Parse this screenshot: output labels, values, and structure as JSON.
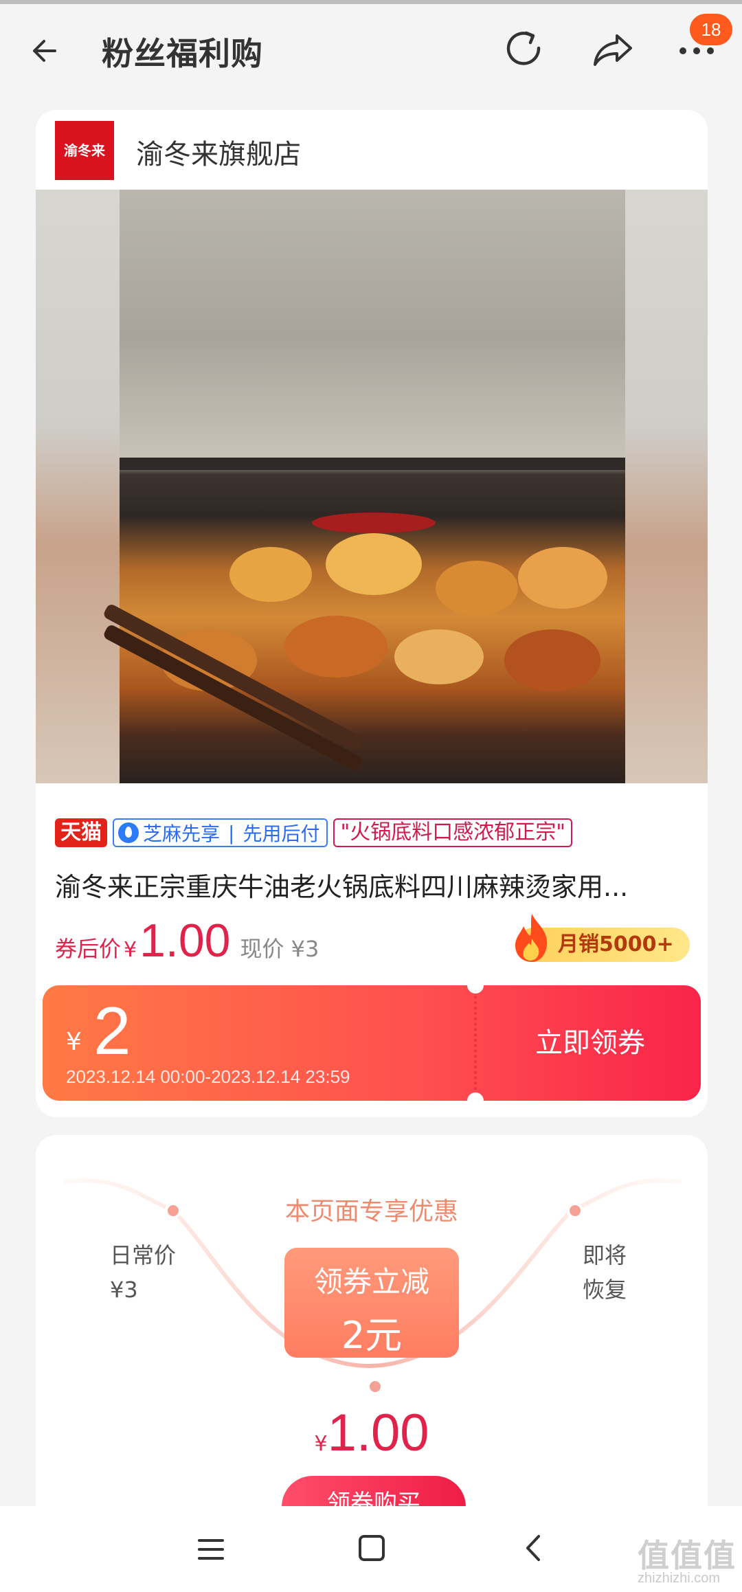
{
  "header": {
    "title": "粉丝福利购",
    "badge_count": "18",
    "icons": [
      "arrow-left-icon",
      "refresh-icon",
      "share-icon",
      "more-dots-icon"
    ]
  },
  "store": {
    "logo_text": "渝冬来",
    "name": "渝冬来旗舰店"
  },
  "product": {
    "tags": {
      "tmall": "天猫",
      "credit_a": "芝麻先享",
      "credit_sep": "|",
      "credit_b": "先用后付",
      "slogan": "\"火锅底料口感浓郁正宗\""
    },
    "title": "渝冬来正宗重庆牛油老火锅底料四川麻辣烫家用...",
    "after_coupon_label": "券后价",
    "currency": "¥",
    "after_coupon_price": "1.00",
    "current_price": "现价 ¥3",
    "monthly_sales": "月销5000+"
  },
  "coupon": {
    "currency": "¥",
    "amount": "2",
    "validity": "2023.12.14 00:00-2023.12.14 23:59",
    "claim_label": "立即领券"
  },
  "promo": {
    "title": "本页面专享优惠",
    "left_label_1": "日常价",
    "left_label_2": "¥3",
    "right_label_1": "即将",
    "right_label_2": "恢复",
    "deal_line1": "领券立减",
    "deal_line2": "2元",
    "final_currency": "¥",
    "final_price": "1.00",
    "buy_label": "领券购买"
  },
  "colors": {
    "accent_red": "#e0234a",
    "coupon_orange": "#ff7a45",
    "tmall_red": "#e2231a",
    "credit_blue": "#2b6cf0"
  },
  "watermark": {
    "main": "值值值",
    "sub": "zhizhizhi.com"
  }
}
